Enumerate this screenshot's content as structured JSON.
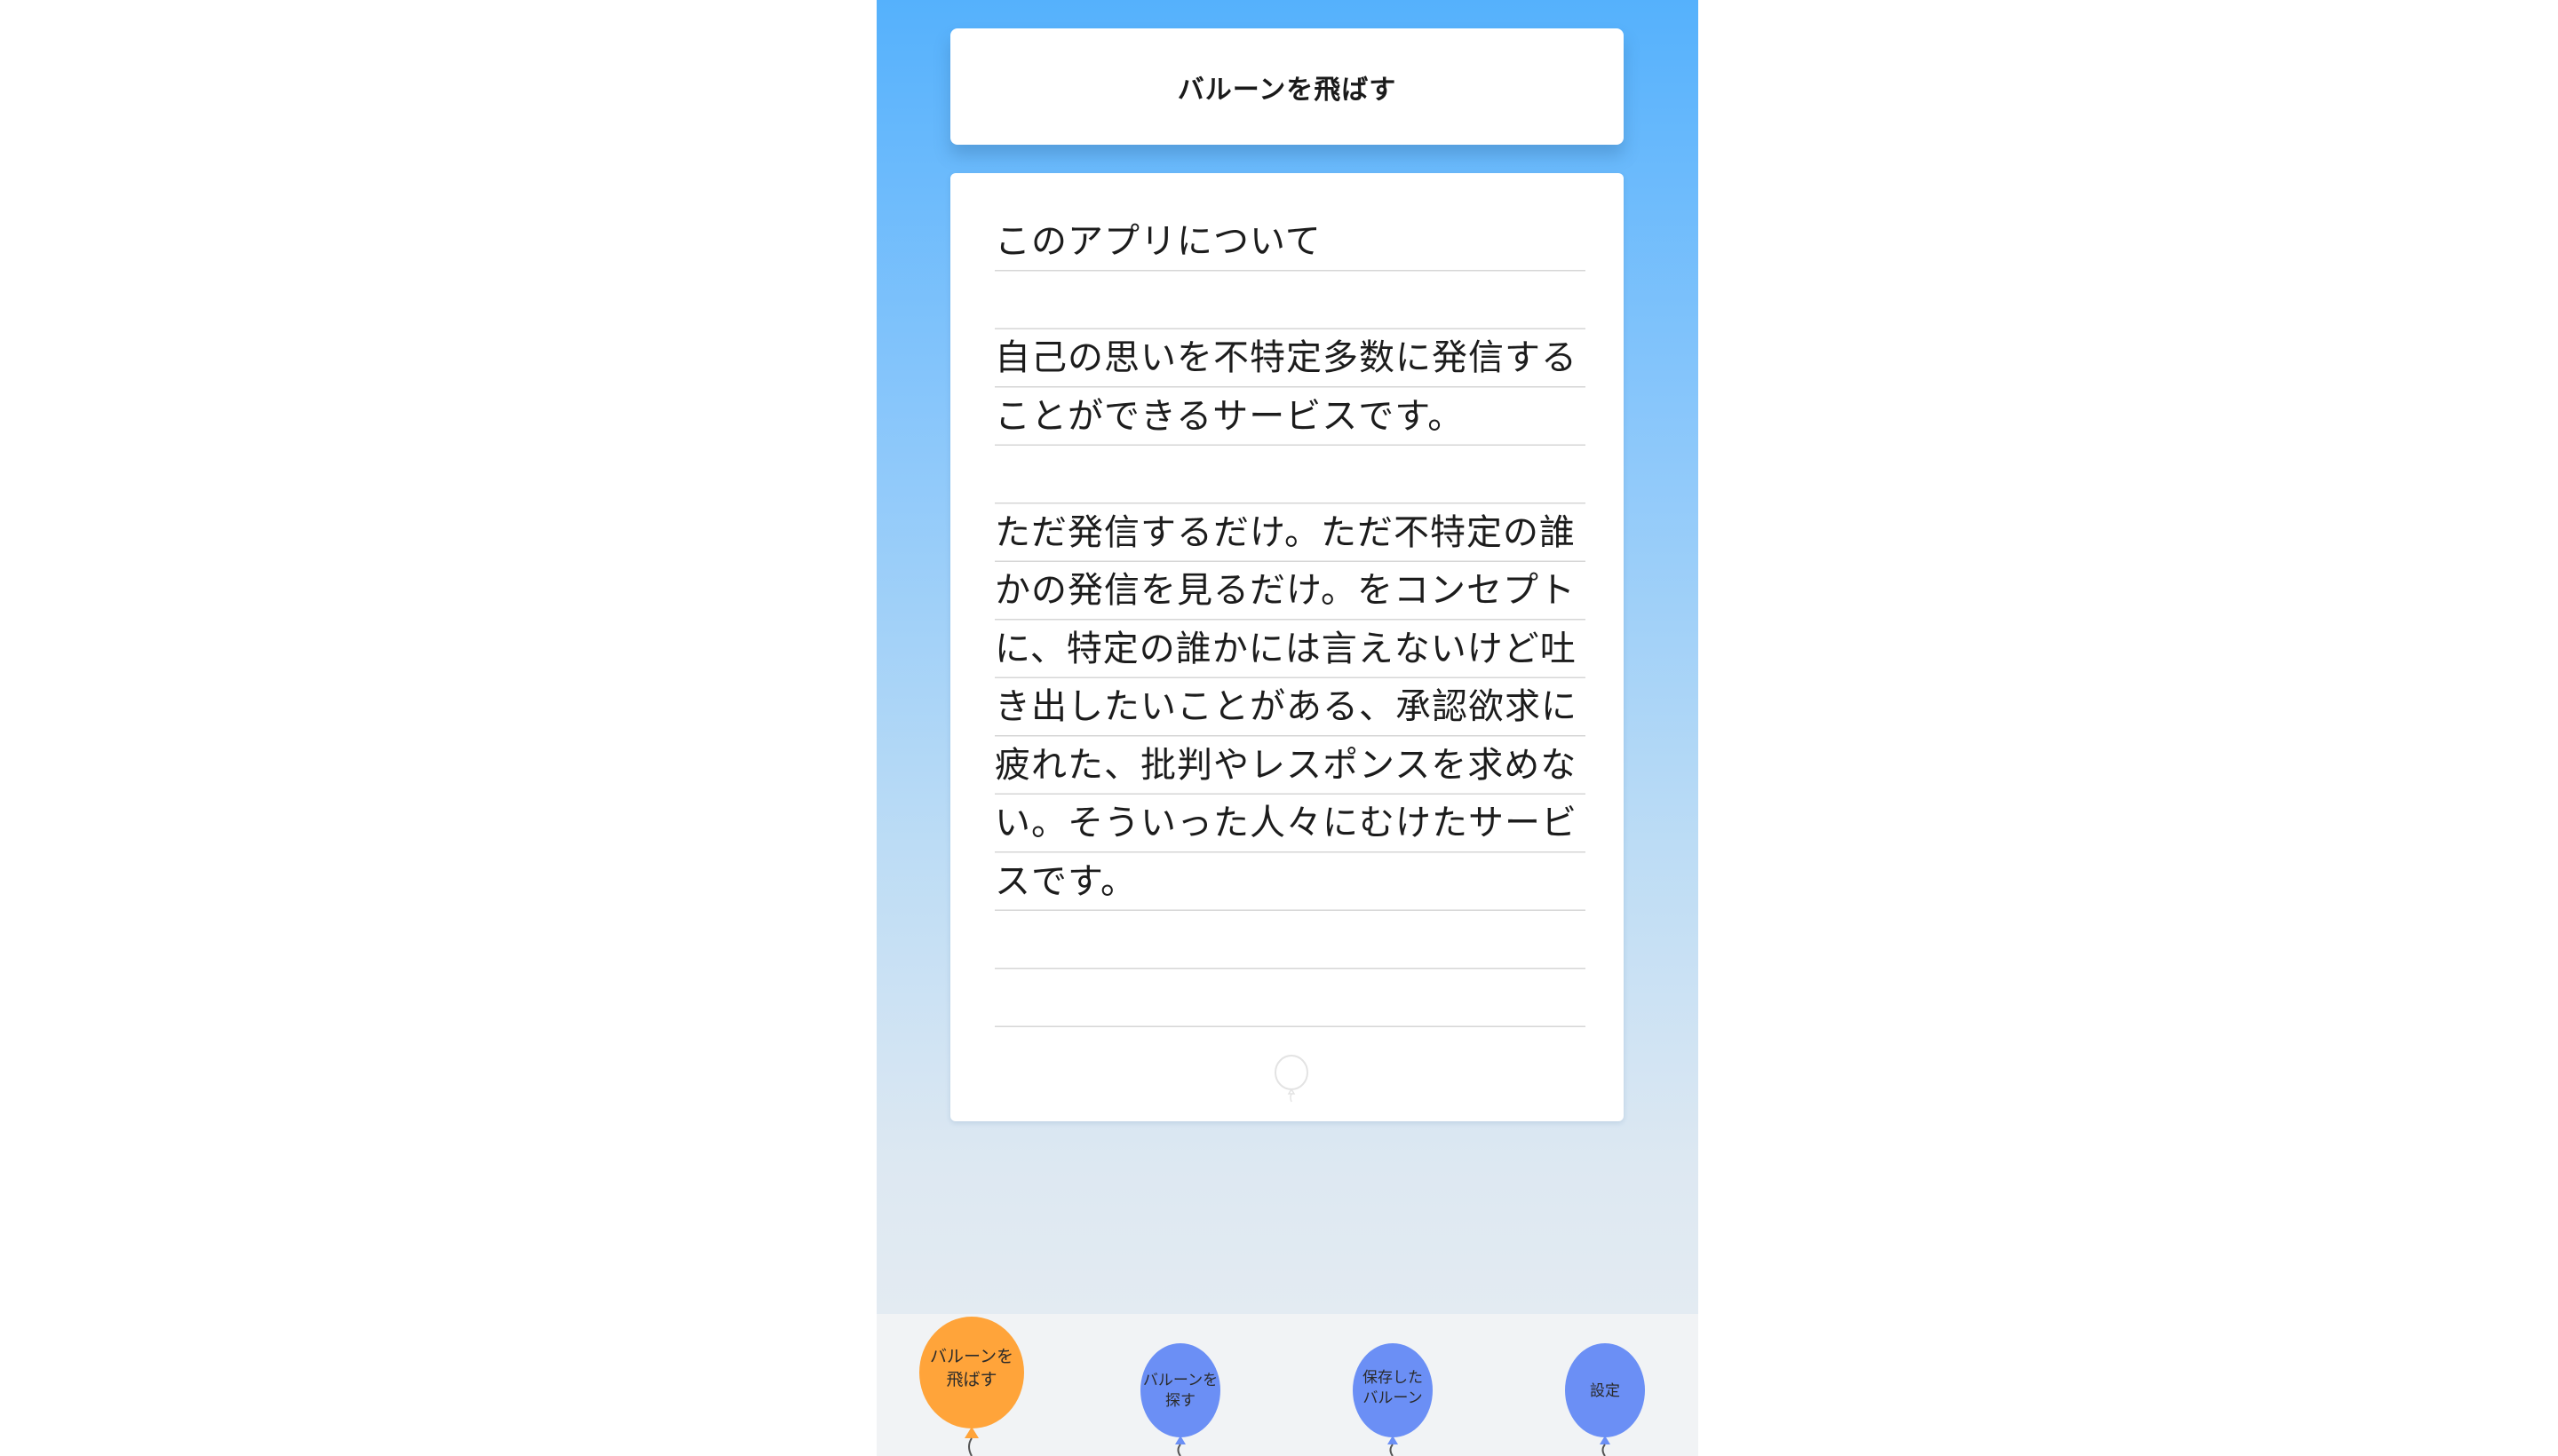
{
  "header": {
    "title": "バルーンを飛ばす"
  },
  "about": {
    "heading": "このアプリについて",
    "body_line1": "自己の思いを不特定多数に発信する",
    "body_line2": "ことができるサービスです。",
    "body_line3": "ただ発信するだけ。ただ不特定の誰",
    "body_line4": "かの発信を見るだけ。をコンセプト",
    "body_line5": "に、特定の誰かには言えないけど吐",
    "body_line6": "き出したいことがある、承認欲求に",
    "body_line7": "疲れた、批判やレスポンスを求めな",
    "body_line8": "い。そういった人々にむけたサービ",
    "body_line9": "スです。",
    "decor_icon": "balloon-outline-icon"
  },
  "tabbar": {
    "items": [
      {
        "label": "バルーンを\n飛ばす",
        "icon": "balloon-icon",
        "color": "#ffa43a",
        "active": true
      },
      {
        "label": "バルーンを\n探す",
        "icon": "balloon-icon",
        "color": "#6b8ff5",
        "active": false
      },
      {
        "label": "保存した\nバルーン",
        "icon": "balloon-icon",
        "color": "#6b8ff5",
        "active": false
      },
      {
        "label": "設定",
        "icon": "balloon-icon",
        "color": "#6b8ff5",
        "active": false
      }
    ]
  },
  "colors": {
    "active_balloon": "#ffa43a",
    "inactive_balloon": "#6b8ff5",
    "gradient_top": "#55b1fc",
    "gradient_bottom": "#e9eef3"
  }
}
